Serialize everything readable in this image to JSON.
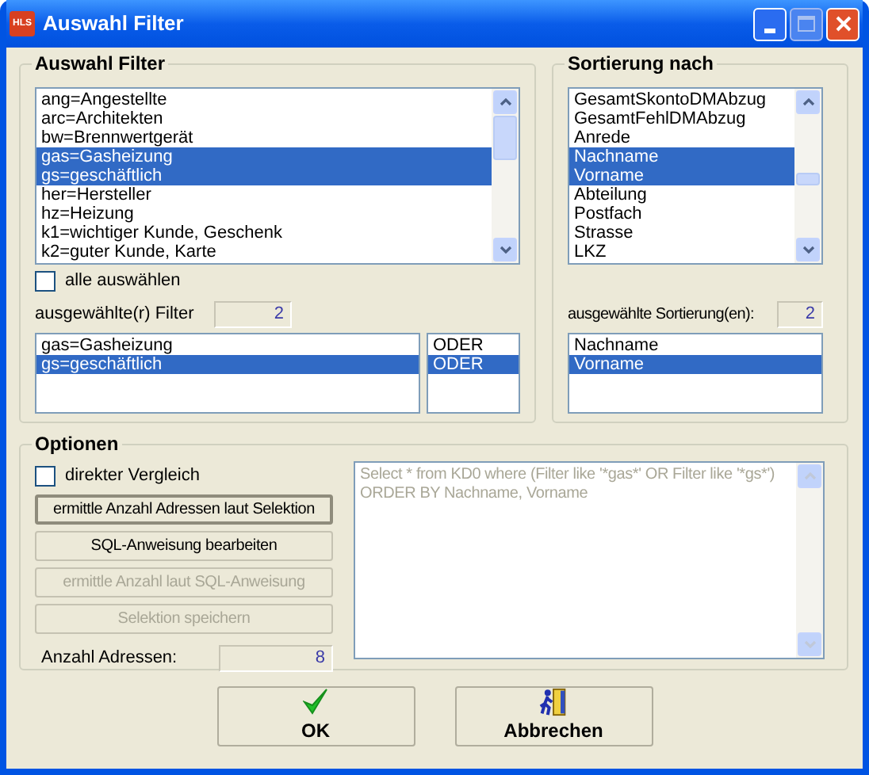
{
  "window": {
    "logo": "HLS",
    "title": "Auswahl Filter"
  },
  "filter_group": {
    "title": "Auswahl Filter",
    "list": [
      {
        "label": "ang=Angestellte",
        "selected": false
      },
      {
        "label": "arc=Architekten",
        "selected": false
      },
      {
        "label": "bw=Brennwertgerät",
        "selected": false
      },
      {
        "label": "gas=Gasheizung",
        "selected": true
      },
      {
        "label": "gs=geschäftlich",
        "selected": true
      },
      {
        "label": "her=Hersteller",
        "selected": false
      },
      {
        "label": "hz=Heizung",
        "selected": false
      },
      {
        "label": "k1=wichtiger Kunde, Geschenk",
        "selected": false
      },
      {
        "label": "k2=guter Kunde, Karte",
        "selected": false
      }
    ],
    "select_all": {
      "label": "alle auswählen",
      "checked": false
    },
    "selected_label": "ausgewählte(r) Filter",
    "selected_count": "2",
    "selected_list": [
      {
        "label": "gas=Gasheizung",
        "selected": false
      },
      {
        "label": "gs=geschäftlich",
        "selected": true
      }
    ],
    "operators": [
      {
        "label": "ODER",
        "selected": false
      },
      {
        "label": "ODER",
        "selected": true
      }
    ]
  },
  "sort_group": {
    "title": "Sortierung nach",
    "list": [
      {
        "label": "GesamtSkontoDMAbzug",
        "selected": false
      },
      {
        "label": "GesamtFehlDMAbzug",
        "selected": false
      },
      {
        "label": "Anrede",
        "selected": false
      },
      {
        "label": "Nachname",
        "selected": true
      },
      {
        "label": "Vorname",
        "selected": true
      },
      {
        "label": "Abteilung",
        "selected": false
      },
      {
        "label": "Postfach",
        "selected": false
      },
      {
        "label": "Strasse",
        "selected": false
      },
      {
        "label": "LKZ",
        "selected": false
      }
    ],
    "selected_label": "ausgewählte Sortierung(en):",
    "selected_count": "2",
    "selected_list": [
      {
        "label": "Nachname",
        "selected": false
      },
      {
        "label": "Vorname",
        "selected": true
      }
    ]
  },
  "options": {
    "title": "Optionen",
    "direct_compare": {
      "label": "direkter Vergleich",
      "checked": false
    },
    "buttons": [
      {
        "label": "ermittle Anzahl Adressen laut Selektion",
        "disabled": false,
        "selected": true
      },
      {
        "label": "SQL-Anweisung bearbeiten",
        "disabled": false,
        "selected": false
      },
      {
        "label": "ermittle Anzahl laut SQL-Anweisung",
        "disabled": true,
        "selected": false
      },
      {
        "label": "Selektion speichern",
        "disabled": true,
        "selected": false
      }
    ],
    "count_label": "Anzahl Adressen:",
    "count": "8",
    "sql": {
      "lines": [
        "Select * from KD0 where (Filter like '*gas*' OR Filter like '*gs*')",
        "ORDER BY Nachname, Vorname"
      ],
      "disabled": true
    }
  },
  "buttons": [
    {
      "label": "OK",
      "kind": "ok"
    },
    {
      "label": "Abbrechen",
      "kind": "cancel"
    }
  ]
}
